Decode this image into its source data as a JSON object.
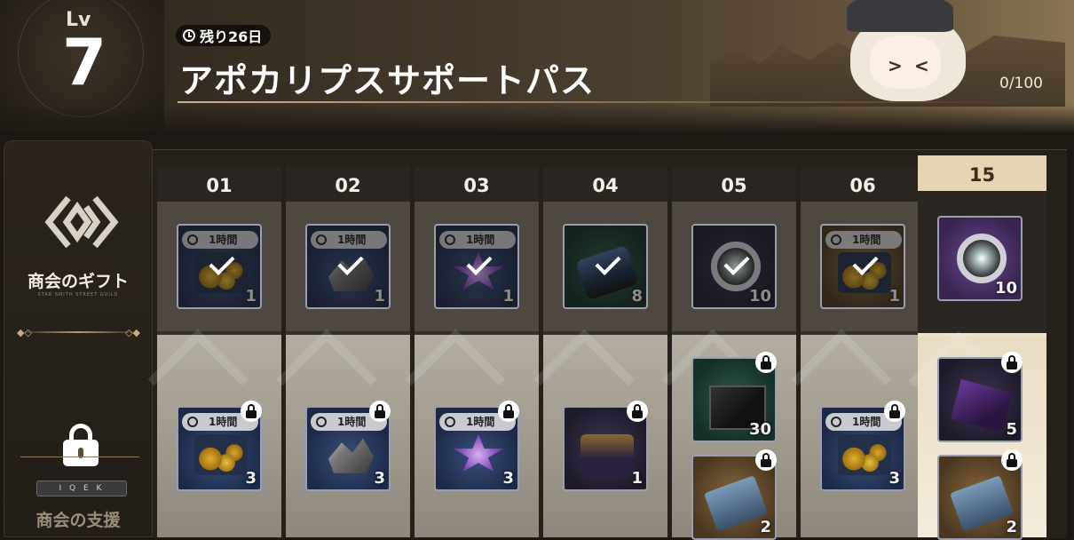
{
  "header": {
    "level_label": "Lv",
    "level": "7",
    "remaining": "残り26日",
    "title": "アポカリプスサポートパス",
    "progress": "0/100"
  },
  "sidebar": {
    "gift_label": "商会のギフト",
    "gift_sub": "STAR SMITH STREET GUILD",
    "code": "I Q E K",
    "support_label": "商会の支援"
  },
  "timer_label": "1時間",
  "columns": [
    {
      "label": "01",
      "top": {
        "count": "1",
        "timer": true,
        "claimed": true
      },
      "bottom": [
        {
          "count": "3",
          "timer": true
        }
      ]
    },
    {
      "label": "02",
      "top": {
        "count": "1",
        "timer": true,
        "claimed": true
      },
      "bottom": [
        {
          "count": "3",
          "timer": true
        }
      ]
    },
    {
      "label": "03",
      "top": {
        "count": "1",
        "timer": true,
        "claimed": true
      },
      "bottom": [
        {
          "count": "3",
          "timer": true
        }
      ]
    },
    {
      "label": "04",
      "top": {
        "count": "8",
        "timer": false,
        "claimed": true
      },
      "bottom": [
        {
          "count": "1",
          "timer": false
        }
      ]
    },
    {
      "label": "05",
      "top": {
        "count": "10",
        "timer": false,
        "claimed": true
      },
      "bottom": [
        {
          "count": "30",
          "timer": false
        },
        {
          "count": "2",
          "timer": false
        }
      ]
    },
    {
      "label": "06",
      "top": {
        "count": "1",
        "timer": true,
        "claimed": true
      },
      "bottom": [
        {
          "count": "3",
          "timer": true
        }
      ]
    },
    {
      "label": "15",
      "top": {
        "count": "10",
        "timer": false,
        "claimed": false
      },
      "bottom": [
        {
          "count": "5",
          "timer": false
        },
        {
          "count": "2",
          "timer": false
        }
      ]
    }
  ]
}
